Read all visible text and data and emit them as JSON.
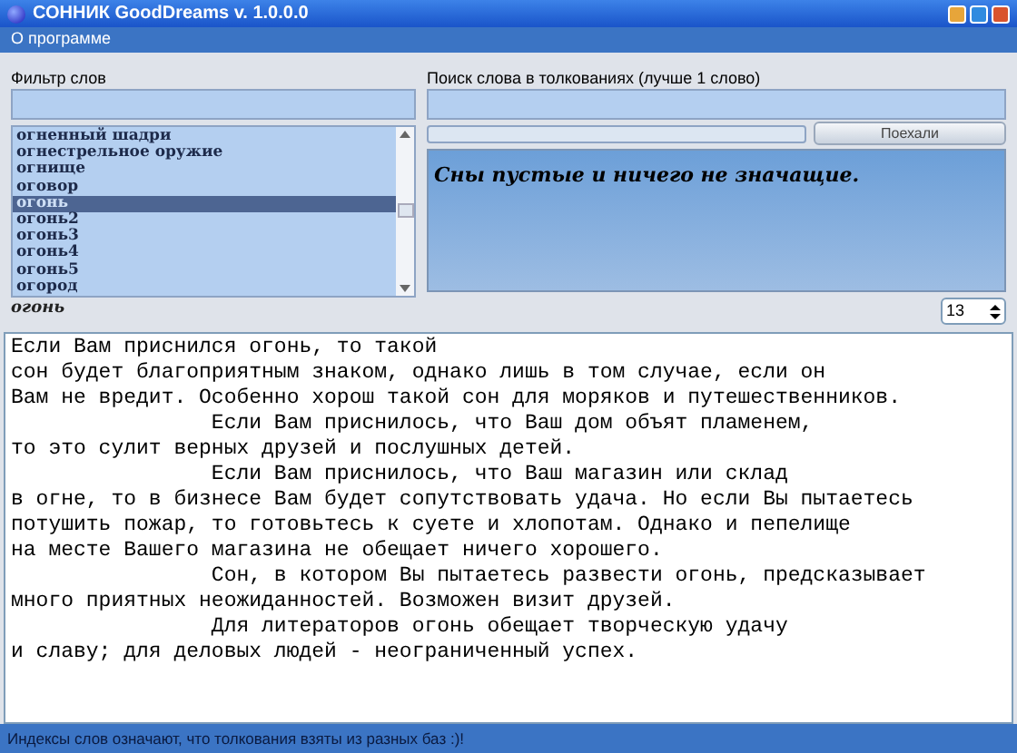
{
  "window": {
    "title": "СОННИК GoodDreams v. 1.0.0.0"
  },
  "menu": [
    "О программе"
  ],
  "filter": {
    "label": "Фильтр слов"
  },
  "words": [
    {
      "text": "огненный шадри",
      "selected": false
    },
    {
      "text": "огнестрельное оружие",
      "selected": false
    },
    {
      "text": "огнище",
      "selected": false
    },
    {
      "text": "оговор",
      "selected": false
    },
    {
      "text": "огонь",
      "selected": true
    },
    {
      "text": "огонь2",
      "selected": false
    },
    {
      "text": "огонь3",
      "selected": false
    },
    {
      "text": "огонь4",
      "selected": false
    },
    {
      "text": "огонь5",
      "selected": false
    },
    {
      "text": "огород",
      "selected": false
    }
  ],
  "current_word": "огонь",
  "search": {
    "label": "Поиск слова в толкованиях (лучше 1 слово)",
    "button": "Поехали"
  },
  "summary": "Сны пустые и ничего не значащие.",
  "font_size": "13",
  "interpretation": "Если Вам приснился огонь, то такой\nсон будет благоприятным знаком, однако лишь в том случае, если он\nВам не вредит. Особенно хорош такой сон для моряков и путешественников.\n                Если Вам приснилось, что Ваш дом объят пламенем,\nто это сулит верных друзей и послушных детей.\n                Если Вам приснилось, что Ваш магазин или склад\nв огне, то в бизнесе Вам будет сопутствовать удача. Но если Вы пытаетесь\nпотушить пожар, то готовьтесь к суете и хлопотам. Однако и пепелище\nна месте Вашего магазина не обещает ничего хорошего.\n                Сон, в котором Вы пытаетесь развести огонь, предсказывает\nмного приятных неожиданностей. Возможен визит друзей.\n                Для литераторов огонь обещает творческую удачу\nи славу; для деловых людей - неограниченный успех.",
  "status_bar": "Индексы слов означают, что толкования взяты из разных баз :)!"
}
